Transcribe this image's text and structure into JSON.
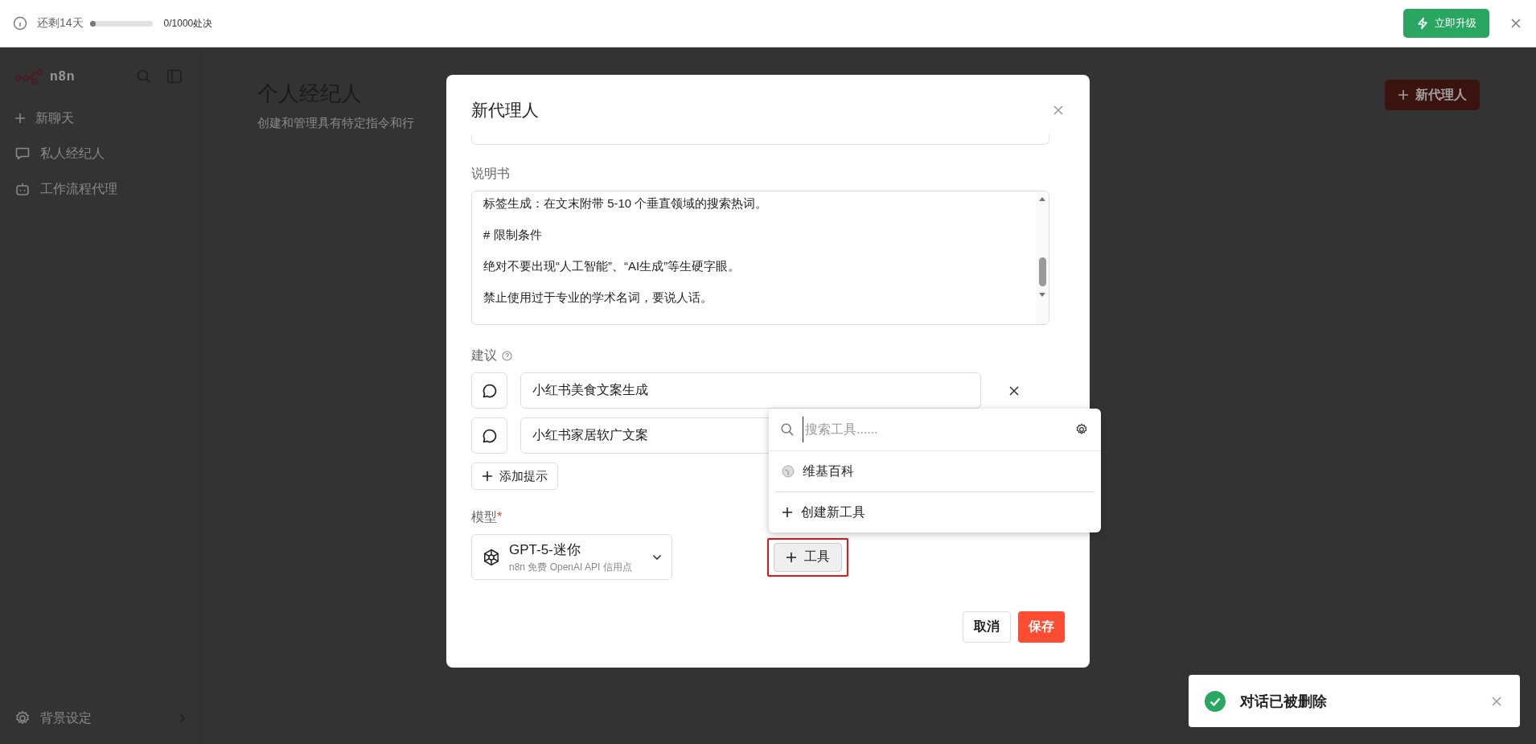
{
  "trial_bar": {
    "days_left": "还剩14天",
    "level": 0.04,
    "usage": "0/1000处决",
    "upgrade_button": "立即升级"
  },
  "sidebar": {
    "logo": "n8n",
    "items": [
      {
        "label": "新聊天",
        "kind": "new"
      },
      {
        "label": "私人经纪人",
        "kind": "chat"
      },
      {
        "label": "工作流程代理",
        "kind": "bot"
      }
    ],
    "footer": "背景设定"
  },
  "page": {
    "title": "个人经纪人",
    "subtitle": "创建和管理具有特定指令和行",
    "new_button": "新代理人"
  },
  "dialog": {
    "title": "新代理人",
    "instructions": {
      "label": "说明书",
      "lines": [
        "标签生成：在文末附带 5-10 个垂直领域的搜索热词。",
        "# 限制条件",
        "绝对不要出现“人工智能”、“AI生成”等生硬字眼。",
        "禁止使用过于专业的学术名词，要说人话。"
      ]
    },
    "suggestions": {
      "label": "建议",
      "items": [
        {
          "text": "小红书美食文案生成"
        },
        {
          "text": "小红书家居软广文案"
        }
      ],
      "add_button": "添加提示"
    },
    "model": {
      "label": "模型",
      "required_mark": "*",
      "name": "GPT-5-迷你",
      "note": "n8n 免费 OpenAI API 信用点"
    },
    "tools_button": {
      "label": "工具",
      "highlighted": true
    },
    "cancel_button": "取消",
    "save_button": "保存"
  },
  "tool_menu": {
    "placeholder": "搜索工具......",
    "items": [
      {
        "label": "维基百科",
        "kind": "tool"
      },
      {
        "label": "创建新工具",
        "kind": "create"
      }
    ]
  },
  "toast": {
    "message": "对话已被删除",
    "kind": "success"
  }
}
